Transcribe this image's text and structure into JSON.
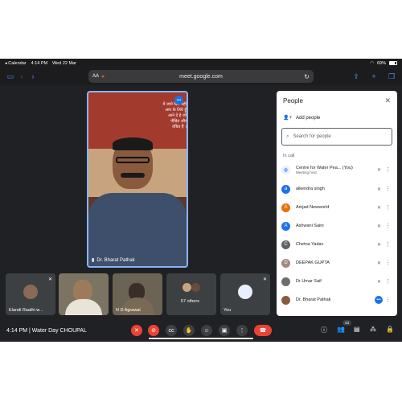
{
  "status_bar": {
    "back_app": "◂ Calendar",
    "time": "4:14 PM",
    "date": "Wed 22 Mar",
    "battery": "69%"
  },
  "browser": {
    "text_size": "AA",
    "url": "meet.google.com"
  },
  "main_tile": {
    "name": "Dr. Bharat Pathak",
    "poster_lines": [
      "में जाने दिले नहीं",
      "आप के लिये हूँ",
      "आने दे हे जो",
      "पीड़ित और",
      "वंचित हैं ।"
    ]
  },
  "thumbnails": [
    {
      "label": "Elandi Raathi w..."
    },
    {
      "label": ""
    },
    {
      "label": "N D Agrawal"
    },
    {
      "label": "57 others"
    },
    {
      "label": "You"
    }
  ],
  "people_panel": {
    "title": "People",
    "add_label": "Add people",
    "search_placeholder": "Search for people",
    "section_label": "In call",
    "participants": [
      {
        "name": "Centre for Water Pea... (You)",
        "sub": "Meeting host",
        "initial": "",
        "color": "#ffffff"
      },
      {
        "name": "alkendra singh",
        "sub": "",
        "initial": "a",
        "color": "#1a73e8"
      },
      {
        "name": "Amjad Newworld",
        "sub": "",
        "initial": "A",
        "color": "#e8710a"
      },
      {
        "name": "Ashwani Saini",
        "sub": "",
        "initial": "A",
        "color": "#1a73e8"
      },
      {
        "name": "Chetna Yadav",
        "sub": "",
        "initial": "C",
        "color": "#5f6368"
      },
      {
        "name": "DEEPAK GUPTA",
        "sub": "",
        "initial": "D",
        "color": "#a1887f"
      },
      {
        "name": "Dr Umar Saif",
        "sub": "",
        "initial": "",
        "color": "#6d6d6d"
      },
      {
        "name": "Dr. Bharat Pathak",
        "sub": "",
        "initial": "",
        "color": "#8a5a3e"
      }
    ]
  },
  "bottom_bar": {
    "meeting_info": "4:14 PM  |  Water Day CHOUPAL",
    "people_count": "43"
  },
  "colors": {
    "accent": "#8ab4f8",
    "danger": "#ea4335",
    "background": "#202124"
  }
}
